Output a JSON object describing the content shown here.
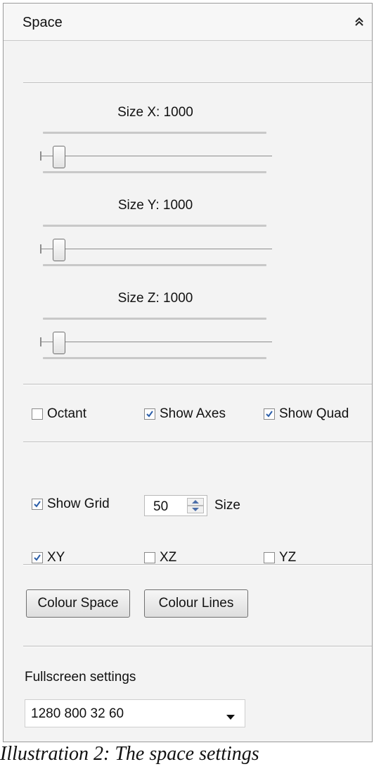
{
  "panel": {
    "title": "Space",
    "collapse_icon": "double-chevron-up-icon"
  },
  "sliders": [
    {
      "label": "Size X: 1000",
      "level": 0.05
    },
    {
      "label": "Size Y: 1000",
      "level": 0.05
    },
    {
      "label": "Size Z: 1000",
      "level": 0.05
    }
  ],
  "toggles": {
    "octant": {
      "label": "Octant",
      "checked": false
    },
    "show_axes": {
      "label": "Show Axes",
      "checked": true
    },
    "show_quad": {
      "label": "Show Quad",
      "checked": true
    }
  },
  "grid": {
    "show_grid": {
      "label": "Show Grid",
      "checked": true
    },
    "size_value": "50",
    "size_label": "Size",
    "planes": [
      {
        "label": "XY",
        "checked": true
      },
      {
        "label": "XZ",
        "checked": false
      },
      {
        "label": "YZ",
        "checked": false
      }
    ]
  },
  "buttons": {
    "colour_space": "Colour Space",
    "colour_lines": "Colour Lines"
  },
  "fullscreen": {
    "label": "Fullscreen settings",
    "selected": "1280 800 32 60"
  },
  "caption": "Illustration 2: The space settings",
  "colors": {
    "panel_bg": "#f3f3f3",
    "check_mark": "#2a5da8"
  }
}
